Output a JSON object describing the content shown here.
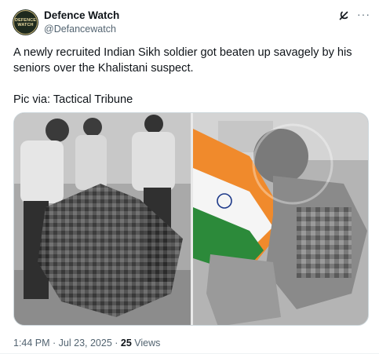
{
  "author": {
    "name": "Defence Watch",
    "handle": "@Defancewatch",
    "avatar_text_1": "DEFENCE",
    "avatar_text_2": "WATCH"
  },
  "tweet": {
    "line1": "A newly recruited Indian Sikh soldier got beaten up savagely by his seniors over the Khalistani suspect.",
    "line2": "Pic via: Tactical Tribune"
  },
  "meta": {
    "time": "1:44 PM",
    "sep1": " · ",
    "date": "Jul 23, 2025",
    "sep2": " · ",
    "views_count": "25",
    "views_label": " Views"
  },
  "icons": {
    "grok": "grok-icon",
    "more": "more-icon"
  },
  "colors": {
    "text": "#0f1419",
    "secondary": "#536471",
    "saffron": "#f08a2c",
    "green": "#2c8a3a"
  }
}
